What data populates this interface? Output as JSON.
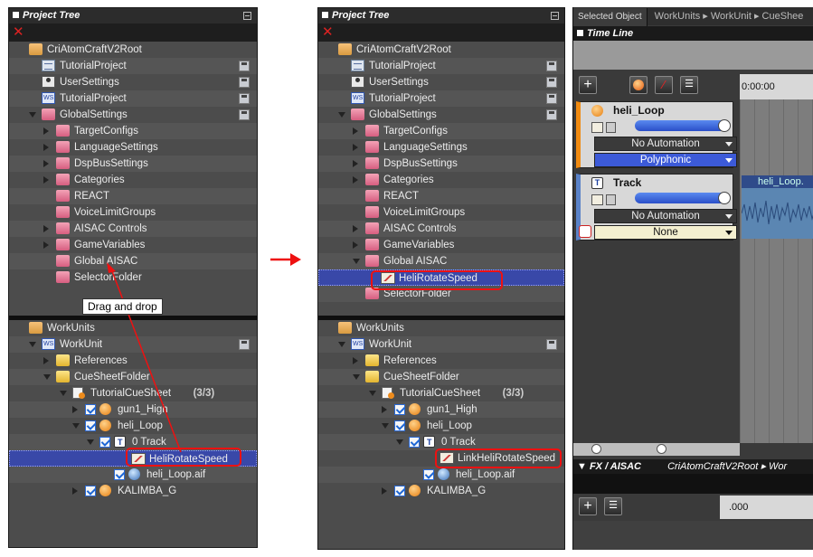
{
  "left": {
    "title": "Project Tree",
    "tooltip": "Drag and drop",
    "top_rows": [
      {
        "label": "CriAtomCraftV2Root",
        "icon": "folder-open-icon",
        "indent": 22,
        "arrow": "",
        "save": false
      },
      {
        "label": "TutorialProject",
        "icon": "document-icon",
        "indent": 36,
        "arrow": "",
        "save": true
      },
      {
        "label": "UserSettings",
        "icon": "user-settings-icon",
        "indent": 36,
        "arrow": "",
        "save": true
      },
      {
        "label": "TutorialProject",
        "icon": "workspace-icon",
        "indent": 36,
        "arrow": "",
        "save": true
      },
      {
        "label": "GlobalSettings",
        "icon": "folder-pink-icon",
        "indent": 36,
        "arrow": "d",
        "save": true
      },
      {
        "label": "TargetConfigs",
        "icon": "folder-pink-icon",
        "indent": 52,
        "arrow": "r",
        "save": false
      },
      {
        "label": "LanguageSettings",
        "icon": "folder-pink-icon",
        "indent": 52,
        "arrow": "r",
        "save": false
      },
      {
        "label": "DspBusSettings",
        "icon": "folder-pink-icon",
        "indent": 52,
        "arrow": "r",
        "save": false
      },
      {
        "label": "Categories",
        "icon": "folder-pink-icon",
        "indent": 52,
        "arrow": "r",
        "save": false
      },
      {
        "label": "REACT",
        "icon": "folder-pink-icon",
        "indent": 52,
        "arrow": "",
        "save": false
      },
      {
        "label": "VoiceLimitGroups",
        "icon": "folder-pink-icon",
        "indent": 52,
        "arrow": "",
        "save": false
      },
      {
        "label": "AISAC Controls",
        "icon": "folder-pink-icon",
        "indent": 52,
        "arrow": "r",
        "save": false
      },
      {
        "label": "GameVariables",
        "icon": "folder-pink-icon",
        "indent": 52,
        "arrow": "r",
        "save": false
      },
      {
        "label": "Global AISAC",
        "icon": "folder-pink-icon",
        "indent": 52,
        "arrow": "",
        "save": false
      },
      {
        "label": "SelectorFolder",
        "icon": "folder-pink-icon",
        "indent": 52,
        "arrow": "",
        "save": false
      }
    ],
    "bottom_rows": [
      {
        "label": "WorkUnits",
        "icon": "folder-open-icon",
        "indent": 22,
        "arrow": "",
        "save": false
      },
      {
        "label": "WorkUnit",
        "icon": "workspace-icon",
        "indent": 36,
        "arrow": "d",
        "save": true
      },
      {
        "label": "References",
        "icon": "folder-yellow-icon",
        "indent": 52,
        "arrow": "r",
        "save": false
      },
      {
        "label": "CueSheetFolder",
        "icon": "folder-yellow-icon",
        "indent": 52,
        "arrow": "d",
        "save": false
      },
      {
        "label": "TutorialCueSheet",
        "extra": "(3/3)",
        "icon": "cue-sheet-icon",
        "indent": 70,
        "arrow": "d",
        "save": false
      },
      {
        "label": "gun1_High",
        "icon": "cue-icon",
        "indent": 84,
        "arrow": "r",
        "check": true,
        "save": false
      },
      {
        "label": "heli_Loop",
        "icon": "cue-icon",
        "indent": 84,
        "arrow": "d",
        "check": true,
        "save": false
      },
      {
        "label": "0   Track",
        "icon": "track-icon",
        "indent": 100,
        "arrow": "d",
        "check": true,
        "save": false
      },
      {
        "label": "HeliRotateSpeed",
        "icon": "aisac-icon",
        "indent": 134,
        "arrow": "",
        "sel": true,
        "save": false
      },
      {
        "label": "heli_Loop.aif",
        "icon": "waveform-icon",
        "indent": 116,
        "arrow": "",
        "check": true,
        "save": false
      },
      {
        "label": "KALIMBA_G",
        "icon": "cue-icon",
        "indent": 84,
        "arrow": "r",
        "check": true,
        "save": false
      }
    ]
  },
  "right": {
    "title": "Project Tree",
    "top_rows": [
      {
        "label": "CriAtomCraftV2Root",
        "icon": "folder-open-icon",
        "indent": 22,
        "arrow": "",
        "save": false
      },
      {
        "label": "TutorialProject",
        "icon": "document-icon",
        "indent": 36,
        "arrow": "",
        "save": true
      },
      {
        "label": "UserSettings",
        "icon": "user-settings-icon",
        "indent": 36,
        "arrow": "",
        "save": true
      },
      {
        "label": "TutorialProject",
        "icon": "workspace-icon",
        "indent": 36,
        "arrow": "",
        "save": true
      },
      {
        "label": "GlobalSettings",
        "icon": "folder-pink-icon",
        "indent": 36,
        "arrow": "d",
        "save": true
      },
      {
        "label": "TargetConfigs",
        "icon": "folder-pink-icon",
        "indent": 52,
        "arrow": "r",
        "save": false
      },
      {
        "label": "LanguageSettings",
        "icon": "folder-pink-icon",
        "indent": 52,
        "arrow": "r",
        "save": false
      },
      {
        "label": "DspBusSettings",
        "icon": "folder-pink-icon",
        "indent": 52,
        "arrow": "r",
        "save": false
      },
      {
        "label": "Categories",
        "icon": "folder-pink-icon",
        "indent": 52,
        "arrow": "r",
        "save": false
      },
      {
        "label": "REACT",
        "icon": "folder-pink-icon",
        "indent": 52,
        "arrow": "",
        "save": false
      },
      {
        "label": "VoiceLimitGroups",
        "icon": "folder-pink-icon",
        "indent": 52,
        "arrow": "",
        "save": false
      },
      {
        "label": "AISAC Controls",
        "icon": "folder-pink-icon",
        "indent": 52,
        "arrow": "r",
        "save": false
      },
      {
        "label": "GameVariables",
        "icon": "folder-pink-icon",
        "indent": 52,
        "arrow": "r",
        "save": false
      },
      {
        "label": "Global AISAC",
        "icon": "folder-pink-icon",
        "indent": 52,
        "arrow": "d",
        "save": false
      },
      {
        "label": "HeliRotateSpeed",
        "icon": "aisac-icon",
        "indent": 68,
        "arrow": "",
        "sel": true,
        "save": false
      },
      {
        "label": "SelectorFolder",
        "icon": "folder-pink-icon",
        "indent": 52,
        "arrow": "",
        "save": false
      }
    ],
    "bottom_rows": [
      {
        "label": "WorkUnits",
        "icon": "folder-open-icon",
        "indent": 22,
        "arrow": "",
        "save": false
      },
      {
        "label": "WorkUnit",
        "icon": "workspace-icon",
        "indent": 36,
        "arrow": "d",
        "save": true
      },
      {
        "label": "References",
        "icon": "folder-yellow-icon",
        "indent": 52,
        "arrow": "r",
        "save": false
      },
      {
        "label": "CueSheetFolder",
        "icon": "folder-yellow-icon",
        "indent": 52,
        "arrow": "d",
        "save": false
      },
      {
        "label": "TutorialCueSheet",
        "extra": "(3/3)",
        "icon": "cue-sheet-icon",
        "indent": 70,
        "arrow": "d",
        "save": false
      },
      {
        "label": "gun1_High",
        "icon": "cue-icon",
        "indent": 84,
        "arrow": "r",
        "check": true,
        "save": false
      },
      {
        "label": "heli_Loop",
        "icon": "cue-icon",
        "indent": 84,
        "arrow": "d",
        "check": true,
        "save": false
      },
      {
        "label": "0   Track",
        "icon": "track-icon",
        "indent": 100,
        "arrow": "d",
        "check": true,
        "save": false
      },
      {
        "label": "LinkHeliRotateSpeed",
        "icon": "aisac-icon",
        "indent": 134,
        "arrow": "",
        "save": false
      },
      {
        "label": "heli_Loop.aif",
        "icon": "waveform-icon",
        "indent": 116,
        "arrow": "",
        "check": true,
        "save": false
      },
      {
        "label": "KALIMBA_G",
        "icon": "cue-icon",
        "indent": 84,
        "arrow": "r",
        "check": true,
        "save": false
      }
    ]
  },
  "editor": {
    "tab_selected": "Selected Object",
    "breadcrumb": [
      "WorkUnits",
      "WorkUnit",
      "CueShee"
    ],
    "timeline_title": "Time Line",
    "time_start": "0:00:00",
    "track1_name": "heli_Loop",
    "track1_automation": "No Automation",
    "track1_mode": "Polyphonic",
    "track2_name": "Track",
    "track2_automation": "No Automation",
    "track2_mode": "None",
    "wave_label": "heli_Loop.",
    "fx_title": "FX / AISAC",
    "fx_path": "CriAtomCraftV2Root ▸ Wor",
    "fx_time": ".000"
  },
  "colors": {
    "highlight": "#e11111",
    "selection": "#3948a8",
    "arrow": "#e11111"
  }
}
